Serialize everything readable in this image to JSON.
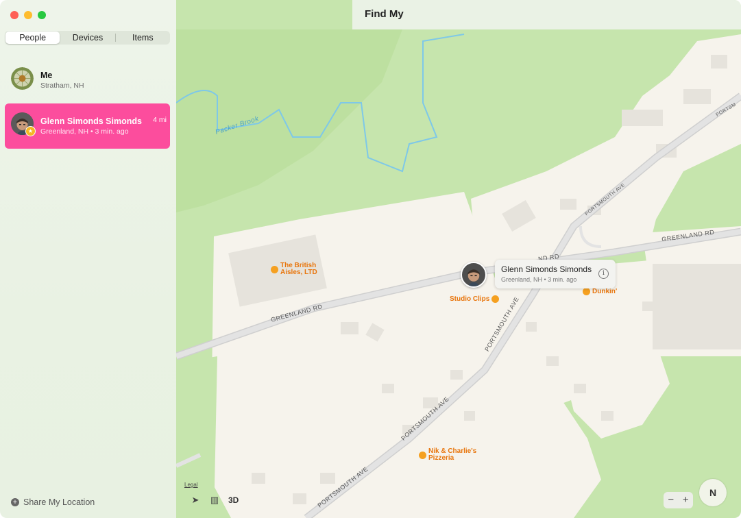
{
  "window": {
    "title": "Find My"
  },
  "tabs": [
    {
      "label": "People",
      "active": true
    },
    {
      "label": "Devices",
      "active": false
    },
    {
      "label": "Items",
      "active": false
    }
  ],
  "people": [
    {
      "name": "Me",
      "location": "Stratham, NH",
      "selected": false
    },
    {
      "name": "Glenn Simonds Simonds",
      "location": "Greenland, NH • 3 min. ago",
      "distance": "4 mi",
      "selected": true
    }
  ],
  "sidebar": {
    "share_label": "Share My Location"
  },
  "map": {
    "callout": {
      "name": "Glenn Simonds Simonds",
      "sub": "Greenland, NH • 3 min. ago"
    },
    "labels": {
      "packer_brook": "Packer Brook",
      "greenland_rd_1": "GREENLAND RD",
      "greenland_rd_2": "GREENLAND RD",
      "greenland_rd_3": "ND RD",
      "portsmouth_1": "PORTSMOUTH AVE",
      "portsmouth_2": "PORTSMOUTH AVE",
      "portsmouth_3": "PORTSMOUTH AVE",
      "portsmouth_4": "PORTSMOUTH AVE",
      "portsmouth_5": "PORTSM"
    },
    "pois": {
      "british_aisles": [
        "The British",
        "Aisles, LTD"
      ],
      "studio_clips": "Studio Clips",
      "dunkin": "Dunkin'",
      "nik_charlie": [
        "Nik & Charlie's",
        "Pizzeria"
      ]
    },
    "legal": "Legal",
    "three_d": "3D",
    "compass": "N",
    "zoom_out": "−",
    "zoom_in": "+"
  },
  "colors": {
    "accent": "#fc4d9d",
    "park": "#c6e5ad",
    "land": "#f6f3ec",
    "road": "#dcdcdc"
  }
}
